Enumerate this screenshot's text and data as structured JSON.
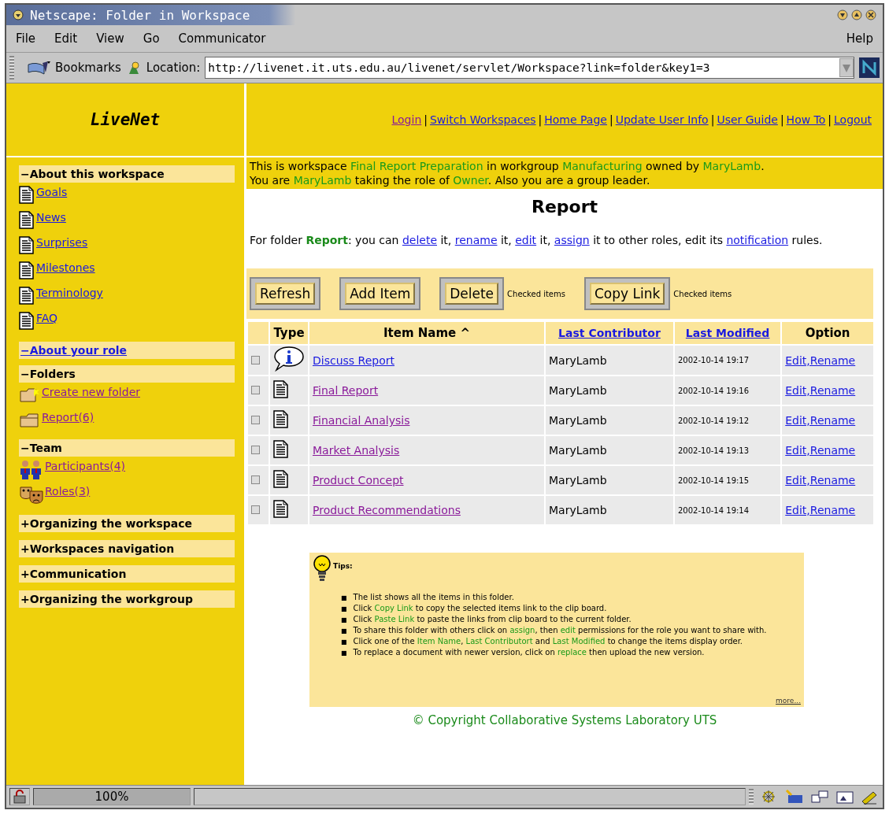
{
  "window": {
    "title": "Netscape: Folder in Workspace"
  },
  "menu": [
    "File",
    "Edit",
    "View",
    "Go",
    "Communicator"
  ],
  "menu_help": "Help",
  "location_bar": {
    "bookmarks": "Bookmarks",
    "label": "Location:",
    "url": "http://livenet.it.uts.edu.au/livenet/servlet/Workspace?link=folder&key1=3"
  },
  "logo": "LiveNet",
  "link_separators": [
    "|",
    "|",
    "|",
    "|",
    "|",
    "|"
  ],
  "top_links": [
    {
      "label": "Login",
      "visited": true
    },
    {
      "label": "Switch Workspaces",
      "visited": false
    },
    {
      "label": "Home Page",
      "visited": false
    },
    {
      "label": "Update User Info",
      "visited": false
    },
    {
      "label": "User Guide",
      "visited": false
    },
    {
      "label": "How To",
      "visited": false
    },
    {
      "label": "Logout",
      "visited": false
    }
  ],
  "sidebar": [
    {
      "label": "−About this workspace",
      "link": false,
      "items": [
        {
          "label": "Goals",
          "kind": "document",
          "visited": false
        },
        {
          "label": "News",
          "kind": "document",
          "visited": false
        },
        {
          "label": "Surprises",
          "kind": "document",
          "visited": false
        },
        {
          "label": "Milestones",
          "kind": "document",
          "visited": false
        },
        {
          "label": "Terminology",
          "kind": "document",
          "visited": false
        },
        {
          "label": "FAQ",
          "kind": "document",
          "visited": false
        }
      ]
    },
    {
      "label": "−About your role",
      "link": true
    },
    {
      "label": "−Folders",
      "link": false,
      "items": [
        {
          "label": "Create new folder",
          "kind": "newfolder",
          "visited": true
        },
        {
          "label": "Report(6)",
          "kind": "folder",
          "visited": true
        }
      ]
    },
    {
      "label": "−Team",
      "link": false,
      "items": [
        {
          "label": "Participants(4)",
          "kind": "people",
          "visited": true
        },
        {
          "label": "Roles(3)",
          "kind": "masks",
          "visited": true
        }
      ]
    },
    {
      "label": "+Organizing the workspace",
      "link": false
    },
    {
      "label": "+Workspaces navigation",
      "link": false
    },
    {
      "label": "+Communication",
      "link": false
    },
    {
      "label": "+Organizing the workgroup",
      "link": false
    }
  ],
  "intro": [
    [
      {
        "text": "This is workspace ",
        "kind": "plain"
      },
      {
        "text": "Final Report Preparation",
        "kind": "term"
      },
      {
        "text": " in workgroup ",
        "kind": "plain"
      },
      {
        "text": "Manufacturing",
        "kind": "term"
      },
      {
        "text": " owned by ",
        "kind": "plain"
      },
      {
        "text": "MaryLamb",
        "kind": "term"
      },
      {
        "text": ".",
        "kind": "plain"
      }
    ],
    [
      {
        "text": "You are ",
        "kind": "plain"
      },
      {
        "text": "MaryLamb",
        "kind": "term"
      },
      {
        "text": " taking the role of ",
        "kind": "plain"
      },
      {
        "text": "Owner",
        "kind": "term"
      },
      {
        "text": ". Also you are a group leader.",
        "kind": "plain"
      }
    ]
  ],
  "heading": "Report",
  "folder_sentence": [
    {
      "text": "For folder ",
      "kind": "plain"
    },
    {
      "text": "Report",
      "kind": "bold"
    },
    {
      "text": ": you can ",
      "kind": "plain"
    },
    {
      "text": "delete",
      "kind": "link"
    },
    {
      "text": " it, ",
      "kind": "plain"
    },
    {
      "text": "rename",
      "kind": "link"
    },
    {
      "text": " it, ",
      "kind": "plain"
    },
    {
      "text": "edit",
      "kind": "link"
    },
    {
      "text": " it, ",
      "kind": "plain"
    },
    {
      "text": "assign",
      "kind": "link"
    },
    {
      "text": " it to other roles, edit its ",
      "kind": "plain"
    },
    {
      "text": "notification",
      "kind": "link"
    },
    {
      "text": " rules.",
      "kind": "plain"
    }
  ],
  "buttons": [
    {
      "label": "Refresh"
    },
    {
      "label": "Add Item"
    },
    {
      "label": "Delete",
      "note": "Checked items"
    },
    {
      "label": "Copy Link",
      "note": "Checked items"
    }
  ],
  "table": {
    "columns": [
      {
        "link": false
      },
      {
        "label": "Type",
        "link": false
      },
      {
        "label": "Item Name ^",
        "link": false
      },
      {
        "label": "Last Contributor",
        "link": true
      },
      {
        "label": "Last Modified",
        "link": true
      },
      {
        "label": "Option",
        "link": false
      }
    ],
    "rows": [
      {
        "checked": false,
        "kind": "discussion",
        "name": "Discuss Report",
        "visited": false,
        "contributor": "MaryLamb",
        "modified": "2002-10-14 19:17",
        "option": "Edit,Rename"
      },
      {
        "checked": false,
        "kind": "document",
        "name": "Final Report",
        "visited": true,
        "contributor": "MaryLamb",
        "modified": "2002-10-14 19:16",
        "option": "Edit,Rename"
      },
      {
        "checked": false,
        "kind": "document",
        "name": "Financial Analysis",
        "visited": true,
        "contributor": "MaryLamb",
        "modified": "2002-10-14 19:12",
        "option": "Edit,Rename"
      },
      {
        "checked": false,
        "kind": "document",
        "name": "Market Analysis",
        "visited": true,
        "contributor": "MaryLamb",
        "modified": "2002-10-14 19:13",
        "option": "Edit,Rename"
      },
      {
        "checked": false,
        "kind": "document",
        "name": "Product Concept",
        "visited": true,
        "contributor": "MaryLamb",
        "modified": "2002-10-14 19:15",
        "option": "Edit,Rename"
      },
      {
        "checked": false,
        "kind": "document",
        "name": "Product Recommendations",
        "visited": true,
        "contributor": "MaryLamb",
        "modified": "2002-10-14 19:14",
        "option": "Edit,Rename"
      }
    ]
  },
  "tips": {
    "title": "Tips:",
    "items": [
      {
        "bullet": "■",
        "parts": [
          {
            "text": "The list shows all the items in this folder.",
            "kind": "plain"
          }
        ]
      },
      {
        "bullet": "■",
        "parts": [
          {
            "text": "Click ",
            "kind": "plain"
          },
          {
            "text": "Copy Link",
            "kind": "term"
          },
          {
            "text": " to copy the selected items link to the clip board.",
            "kind": "plain"
          }
        ]
      },
      {
        "bullet": "■",
        "parts": [
          {
            "text": "Click ",
            "kind": "plain"
          },
          {
            "text": "Paste Link",
            "kind": "term"
          },
          {
            "text": " to paste the links from clip board to the current folder.",
            "kind": "plain"
          }
        ]
      },
      {
        "bullet": "■",
        "parts": [
          {
            "text": "To share this folder with others click on ",
            "kind": "plain"
          },
          {
            "text": "assign",
            "kind": "term"
          },
          {
            "text": ", then ",
            "kind": "plain"
          },
          {
            "text": "edit",
            "kind": "term"
          },
          {
            "text": " permissions for the role you want to share with.",
            "kind": "plain"
          }
        ]
      },
      {
        "bullet": "■",
        "parts": [
          {
            "text": "Click one of the ",
            "kind": "plain"
          },
          {
            "text": "Item Name",
            "kind": "term"
          },
          {
            "text": ", ",
            "kind": "plain"
          },
          {
            "text": "Last Contributort",
            "kind": "term"
          },
          {
            "text": " and ",
            "kind": "plain"
          },
          {
            "text": "Last Modified",
            "kind": "term"
          },
          {
            "text": " to change the items display order.",
            "kind": "plain"
          }
        ]
      },
      {
        "bullet": "■",
        "parts": [
          {
            "text": "To replace a document with newer version, click on ",
            "kind": "plain"
          },
          {
            "text": "replace",
            "kind": "term"
          },
          {
            "text": " then upload the new version.",
            "kind": "plain"
          }
        ]
      }
    ],
    "more": "more..."
  },
  "copyright": "© Copyright Collaborative Systems Laboratory UTS",
  "status_bar": {
    "zoom": "100%"
  }
}
